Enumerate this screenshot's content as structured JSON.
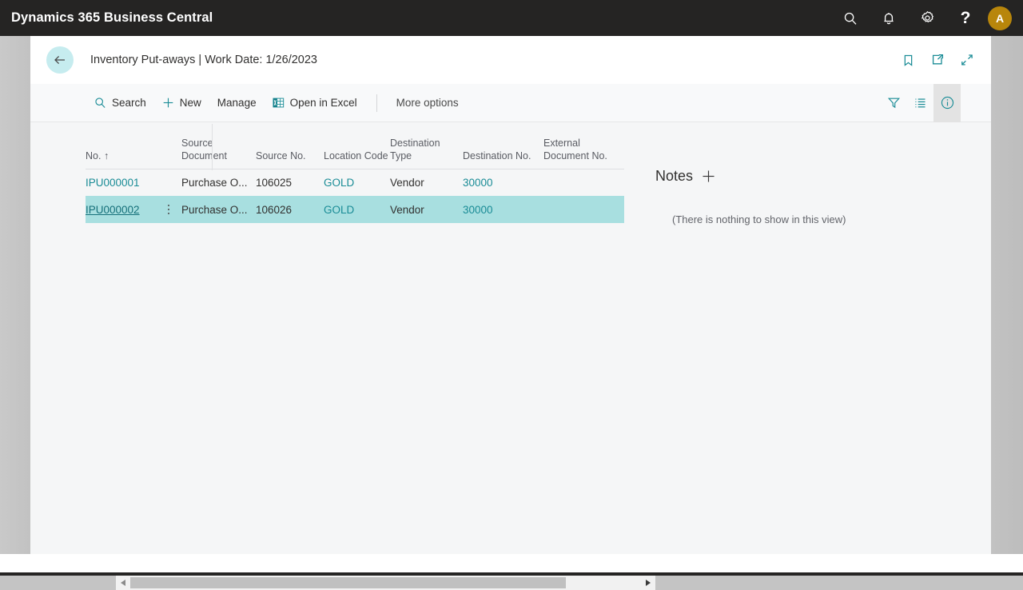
{
  "app_bar": {
    "title": "Dynamics 365 Business Central",
    "icons": [
      {
        "name": "search-icon",
        "label": "Search"
      },
      {
        "name": "notification-bell-icon",
        "label": "Notifications"
      },
      {
        "name": "gear-icon",
        "label": "Settings"
      },
      {
        "name": "help-question-icon",
        "label": "?"
      }
    ],
    "avatar_initial": "A",
    "avatar_color": "#b8860b",
    "background_color": "#252423"
  },
  "page_header": {
    "back_button": "back-arrow-icon",
    "title": "Inventory Put-aways | Work Date: 1/26/2023",
    "actions": [
      {
        "name": "bookmark-icon",
        "label": "Bookmark"
      },
      {
        "name": "open-in-new-window-icon",
        "label": "Open in new window"
      },
      {
        "name": "collapse-icon",
        "label": "Collapse"
      }
    ]
  },
  "toolbar": {
    "search_label": "Search",
    "new_label": "New",
    "manage_label": "Manage",
    "excel_label": "Open in Excel",
    "more_options_label": "More options",
    "right_icons": [
      {
        "name": "filter-icon",
        "label": "Filter",
        "active": false
      },
      {
        "name": "list-view-icon",
        "label": "List view",
        "active": false
      },
      {
        "name": "info-icon",
        "label": "Show details",
        "active": true
      }
    ]
  },
  "table": {
    "columns": [
      {
        "key": "no",
        "label": "No.",
        "sort": "↑"
      },
      {
        "key": "source_document",
        "label": "Source Document"
      },
      {
        "key": "source_no",
        "label": "Source No."
      },
      {
        "key": "location_code",
        "label": "Location Code"
      },
      {
        "key": "destination_type",
        "label": "Destination Type"
      },
      {
        "key": "destination_no",
        "label": "Destination No."
      },
      {
        "key": "external_document_no",
        "label": "External Document No."
      }
    ],
    "rows": [
      {
        "no": "IPU000001",
        "source_document": "Purchase O...",
        "source_no": "106025",
        "location_code": "GOLD",
        "destination_type": "Vendor",
        "destination_no": "30000",
        "external_document_no": "",
        "selected": false
      },
      {
        "no": "IPU000002",
        "source_document": "Purchase O...",
        "source_no": "106026",
        "location_code": "GOLD",
        "destination_type": "Vendor",
        "destination_no": "30000",
        "external_document_no": "",
        "selected": true
      }
    ],
    "selected_row_color": "#a8dfe0",
    "link_color": "#1a8c96"
  },
  "notes": {
    "title": "Notes",
    "add_label": "+",
    "empty_message": "(There is nothing to show in this view)"
  },
  "scrollbar": {
    "left_arrow": "◀",
    "right_arrow": "▶"
  }
}
